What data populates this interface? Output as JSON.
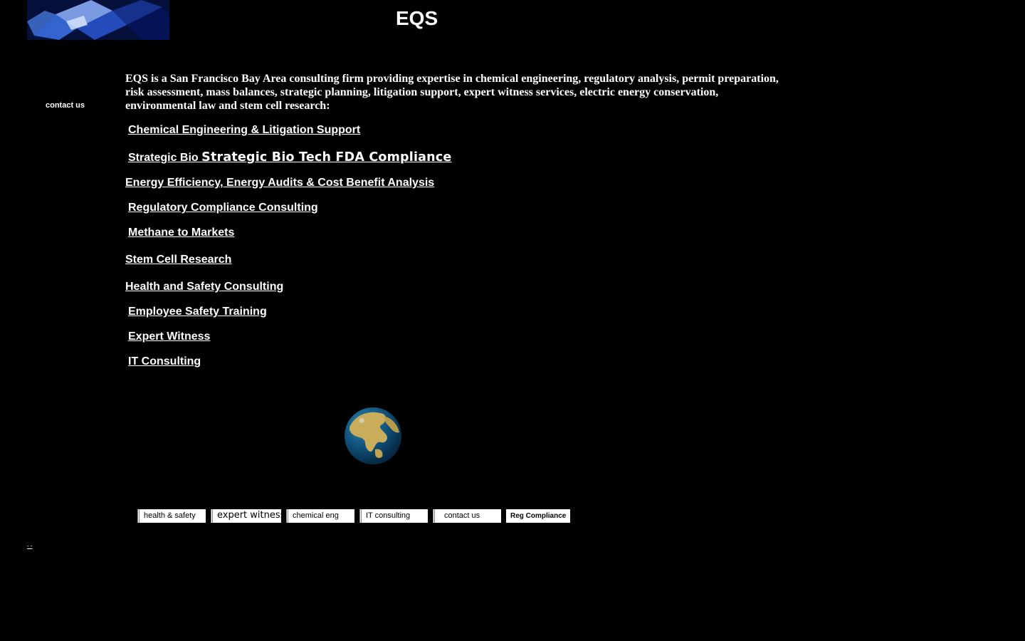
{
  "header": {
    "title": "EQS"
  },
  "sidebar": {
    "contact_label": "contact us"
  },
  "intro": {
    "text": "EQS is a San Francisco Bay Area consulting firm providing expertise in chemical engineering, regulatory analysis, permit preparation, risk assessment, mass balances, strategic planning, litigation support, expert witness services, electric energy conservation, environmental law and stem cell research:"
  },
  "services": {
    "chemical": "Chemical Engineering & Litigation Support",
    "biotech_prefix": "Strategic Bio ",
    "biotech_main": "Strategic Bio Tech FDA Compliance",
    "energy": " Energy Efficiency, Energy Audits & Cost Benefit Analysis",
    "regulatory": "Regulatory Compliance Consulting",
    "methane": "Methane to Markets",
    "stemcell": " Stem Cell Research",
    "health": " Health and Safety Consulting",
    "training": "Employee Safety Training",
    "expert": "Expert Witness",
    "it": "IT Consulting"
  },
  "bottom_nav": {
    "health_safety": "health & safety",
    "expert_witness": "expert witness",
    "chemical_eng": "chemical eng",
    "it_consulting": "IT consulting",
    "contact_us": "contact us",
    "reg_compliance": "Reg Compliance"
  },
  "footer": {
    "mark": "- -"
  }
}
